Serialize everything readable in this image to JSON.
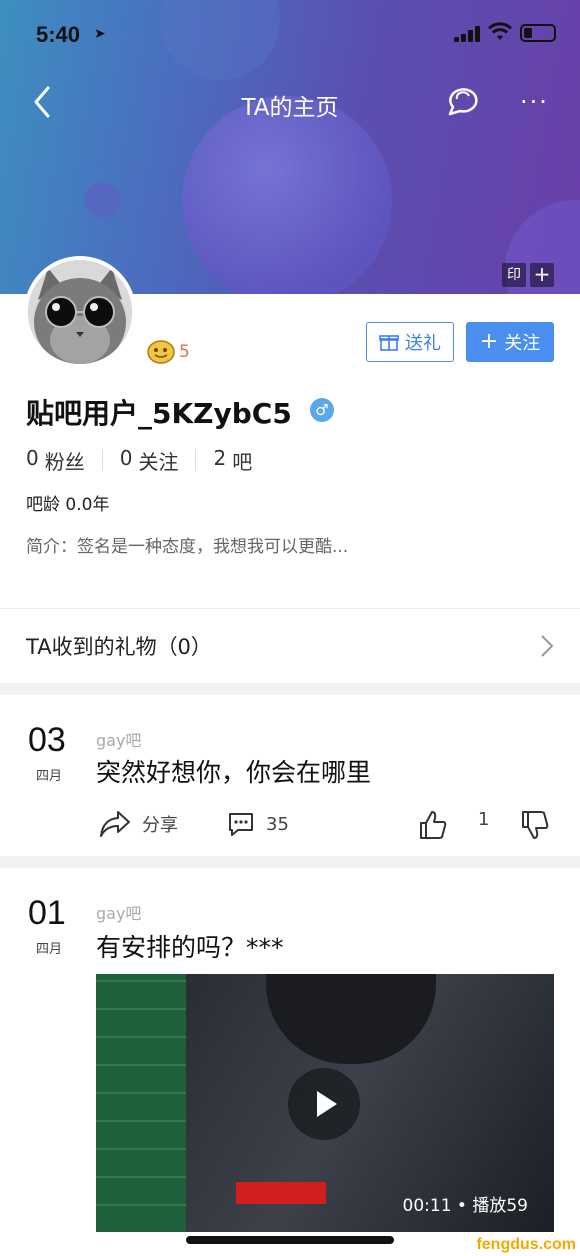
{
  "status": {
    "time": "5:40"
  },
  "nav": {
    "title": "TA的主页"
  },
  "banner": {
    "stamp_label": "印",
    "plus_label": "+"
  },
  "profile": {
    "level": "5",
    "gift_button": "送礼",
    "follow_button": "关注",
    "username": "贴吧用户_5KZybC5",
    "gender_symbol": "♂",
    "stats": [
      {
        "num": "0",
        "label": "粉丝"
      },
      {
        "num": "0",
        "label": "关注"
      },
      {
        "num": "2",
        "label": "吧"
      }
    ],
    "age": "吧龄 0.0年",
    "bio": "简介：签名是一种态度，我想我可以更酷..."
  },
  "gifts": {
    "label": "TA收到的礼物（0）"
  },
  "posts": [
    {
      "day": "03",
      "month": "四月",
      "forum": "gay吧",
      "title": "突然好想你，你会在哪里",
      "share_label": "分享",
      "comments": "35",
      "likes": "1"
    },
    {
      "day": "01",
      "month": "四月",
      "forum": "gay吧",
      "title": "有安排的吗？***",
      "video_duration": "00:11",
      "video_plays": "播放59"
    }
  ],
  "watermark": "fengdus.com",
  "colors": {
    "accent": "#4a8ff0",
    "level": "#e4704a",
    "gender": "#5aa8e8"
  }
}
